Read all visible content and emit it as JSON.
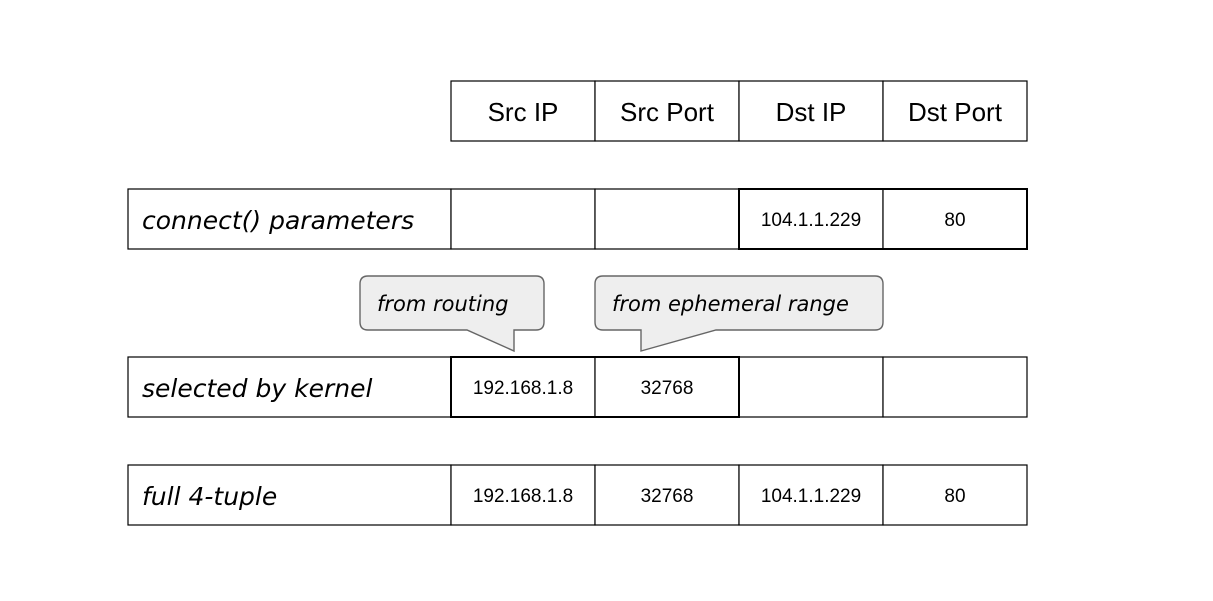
{
  "headers": [
    "Src IP",
    "Src Port",
    "Dst IP",
    "Dst Port"
  ],
  "rows": [
    {
      "label": "connect() parameters",
      "cells": [
        "",
        "",
        "104.1.1.229",
        "80"
      ]
    },
    {
      "label": "selected by kernel",
      "cells": [
        "192.168.1.8",
        "32768",
        "",
        ""
      ]
    },
    {
      "label": "full 4-tuple",
      "cells": [
        "192.168.1.8",
        "32768",
        "104.1.1.229",
        "80"
      ]
    }
  ],
  "callouts": [
    {
      "text": "from routing"
    },
    {
      "text": "from ephemeral range"
    }
  ],
  "colors": {
    "callout_fill": "#eeeeee",
    "callout_stroke": "#666666",
    "line": "#000000"
  }
}
